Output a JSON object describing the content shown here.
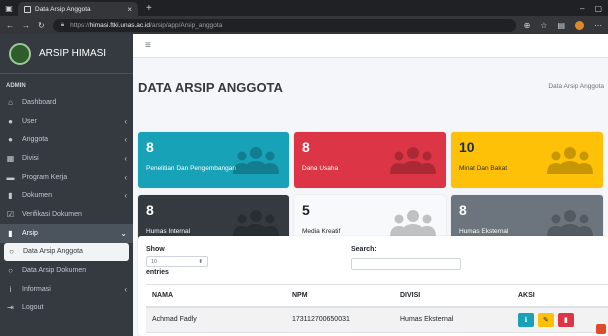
{
  "browser": {
    "tab_title": "Data Arsip Anggota",
    "url_scheme": "https://",
    "url_host": "himasi.ftki.unas.ac.id",
    "url_path": "/arsip/app/Arsip_anggota"
  },
  "sidebar": {
    "brand": "ARSIP HIMASI",
    "section_header": "ADMIN",
    "items": [
      {
        "label": "Dashboard",
        "icon": "dashboard-icon",
        "glyph": "⌂",
        "chevron": false
      },
      {
        "label": "User",
        "icon": "user-icon",
        "glyph": "●",
        "chevron": true
      },
      {
        "label": "Anggota",
        "icon": "users-icon",
        "glyph": "●",
        "chevron": true
      },
      {
        "label": "Divisi",
        "icon": "building-icon",
        "glyph": "▦",
        "chevron": true
      },
      {
        "label": "Program Kerja",
        "icon": "briefcase-icon",
        "glyph": "▬",
        "chevron": true
      },
      {
        "label": "Dokumen",
        "icon": "file-icon",
        "glyph": "▮",
        "chevron": true
      },
      {
        "label": "Verifikasi Dokumen",
        "icon": "check-square-icon",
        "glyph": "☑",
        "chevron": false
      },
      {
        "label": "Arsip",
        "icon": "file-archive-icon",
        "glyph": "▮",
        "chevron": true
      },
      {
        "label": "Data Arsip Anggota",
        "icon": "circle-icon",
        "glyph": "○",
        "chevron": false
      },
      {
        "label": "Data Arsip Dokumen",
        "icon": "circle-icon",
        "glyph": "○",
        "chevron": false
      },
      {
        "label": "Informasi",
        "icon": "info-icon",
        "glyph": "i",
        "chevron": true
      },
      {
        "label": "Logout",
        "icon": "logout-icon",
        "glyph": "⇥",
        "chevron": false
      }
    ]
  },
  "header": {
    "title": "DATA ARSIP ANGGOTA",
    "breadcrumb": "Data Arsip Anggota"
  },
  "stat_boxes": [
    {
      "value": "8",
      "label": "Penelitian Dan Pengembangan",
      "color": "#17a2b8"
    },
    {
      "value": "8",
      "label": "Dana Usaha",
      "color": "#dc3545"
    },
    {
      "value": "10",
      "label": "Minat Dan Bakat",
      "color": "#ffc107"
    },
    {
      "value": "8",
      "label": "Humas Internal",
      "color": "#343a40"
    },
    {
      "value": "5",
      "label": "Media Kreatif",
      "color": "#f8f9fa"
    },
    {
      "value": "8",
      "label": "Humas Eksternal",
      "color": "#6c757d"
    }
  ],
  "table": {
    "show_label": "Show",
    "length_value": "10",
    "entries_label": "entries",
    "search_label": "Search:",
    "columns": [
      "NAMA",
      "NPM",
      "DIVISI",
      "AKSI"
    ],
    "rows": [
      {
        "nama": "Achmad Fadly",
        "npm": "173112700650031",
        "divisi": "Humas Eksternal"
      }
    ]
  }
}
